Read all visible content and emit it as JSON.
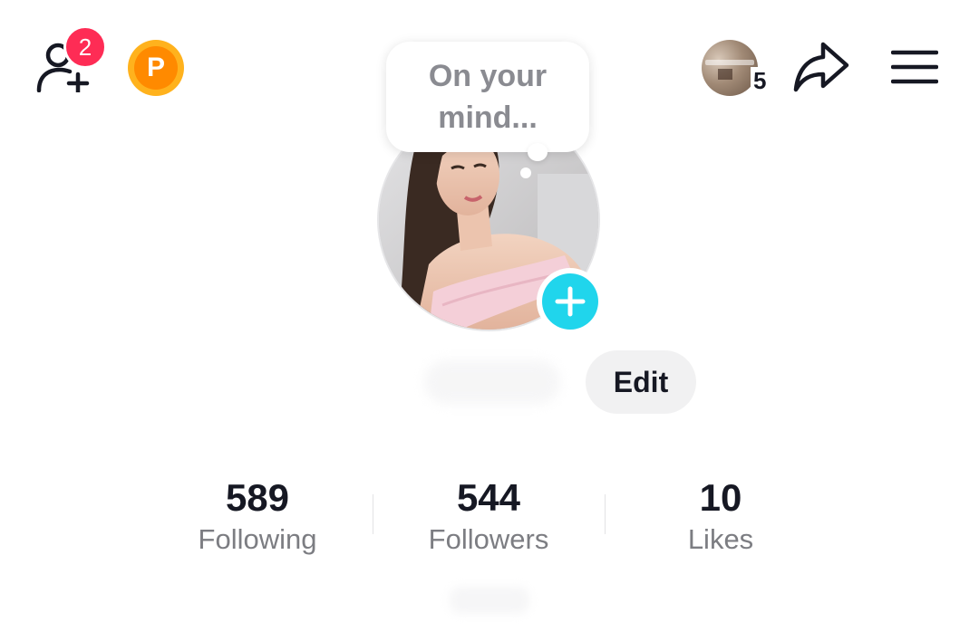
{
  "header": {
    "friend_requests_count": "2",
    "coin_letter": "P",
    "profile_visitors_count": "5"
  },
  "profile": {
    "note_placeholder": "On your mind...",
    "edit_label": "Edit"
  },
  "stats": [
    {
      "value": "589",
      "label": "Following"
    },
    {
      "value": "544",
      "label": "Followers"
    },
    {
      "value": "10",
      "label": "Likes"
    }
  ],
  "colors": {
    "badge": "#fe2c55",
    "coin": "#ffb21d",
    "add_story": "#20d5ec"
  }
}
